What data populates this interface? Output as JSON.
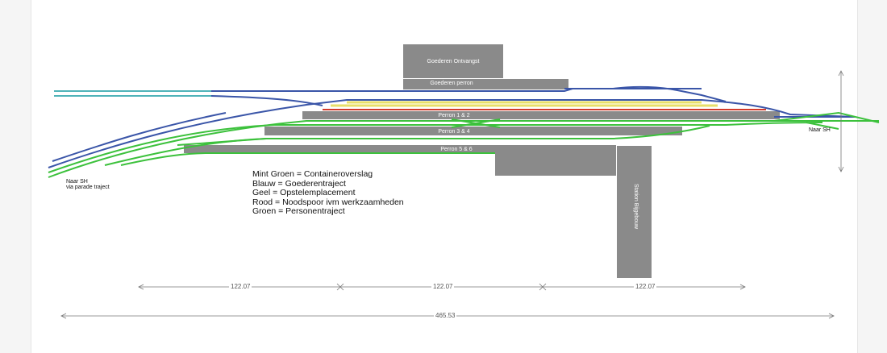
{
  "legend": {
    "mint": "Mint Groen = Containeroverslag",
    "blue": "Blauw = Goederentraject",
    "yellow": "Geel = Opstelemplacement",
    "red": "Rood = Noodspoor ivm werkzaamheden",
    "green": "Groen = Personentraject"
  },
  "labels": {
    "goods_receipt": "Goederen Ontvangst",
    "goods_platform": "Goederen perron",
    "platform_12": "Perron 1 & 2",
    "platform_34": "Perron 3 & 4",
    "platform_56": "Perron 5 & 6",
    "station": "Station Bijgebouw",
    "left_dest_1": "Naar SH",
    "left_dest_2": "via parade traject",
    "right_dest": "Naar SH"
  },
  "dimensions": {
    "seg1": "122.07",
    "seg2": "122.07",
    "seg3": "122.07",
    "total": "465.53"
  },
  "colors": {
    "mint": "#4fb3b8",
    "blue": "#3a55a8",
    "yellow": "#e8df6a",
    "red": "#d23a2a",
    "green": "#3cc13c",
    "building": "#8a8a8a"
  }
}
